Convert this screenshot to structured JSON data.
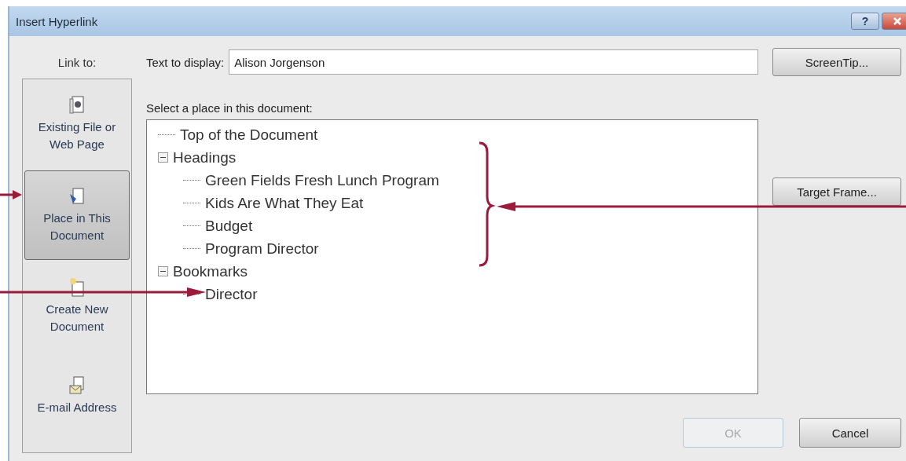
{
  "window": {
    "title": "Insert Hyperlink",
    "help_button": "?"
  },
  "link_to": {
    "label": "Link to:",
    "items": [
      {
        "label": "Existing File or Web Page",
        "kind": "web",
        "selected": false
      },
      {
        "label": "Place in This Document",
        "kind": "place",
        "selected": true
      },
      {
        "label": "Create New Document",
        "kind": "new",
        "selected": false
      },
      {
        "label": "E-mail Address",
        "kind": "mail",
        "selected": false
      }
    ]
  },
  "text_to_display": {
    "label": "Text to display:",
    "value": "Alison Jorgenson"
  },
  "place_label": "Select a place in this document:",
  "tree": [
    {
      "label": "Top of the Document"
    },
    {
      "label": "Headings",
      "expanded": true,
      "children": [
        {
          "label": "Green Fields Fresh Lunch Program"
        },
        {
          "label": "Kids Are What They Eat"
        },
        {
          "label": "Budget"
        },
        {
          "label": "Program Director"
        }
      ]
    },
    {
      "label": "Bookmarks",
      "expanded": true,
      "children": [
        {
          "label": "Director"
        }
      ]
    }
  ],
  "side_buttons": [
    {
      "label": "ScreenTip..."
    },
    {
      "label": "Target Frame..."
    }
  ],
  "buttons": [
    {
      "label": "OK",
      "disabled": true
    },
    {
      "label": "Cancel",
      "disabled": false
    }
  ]
}
